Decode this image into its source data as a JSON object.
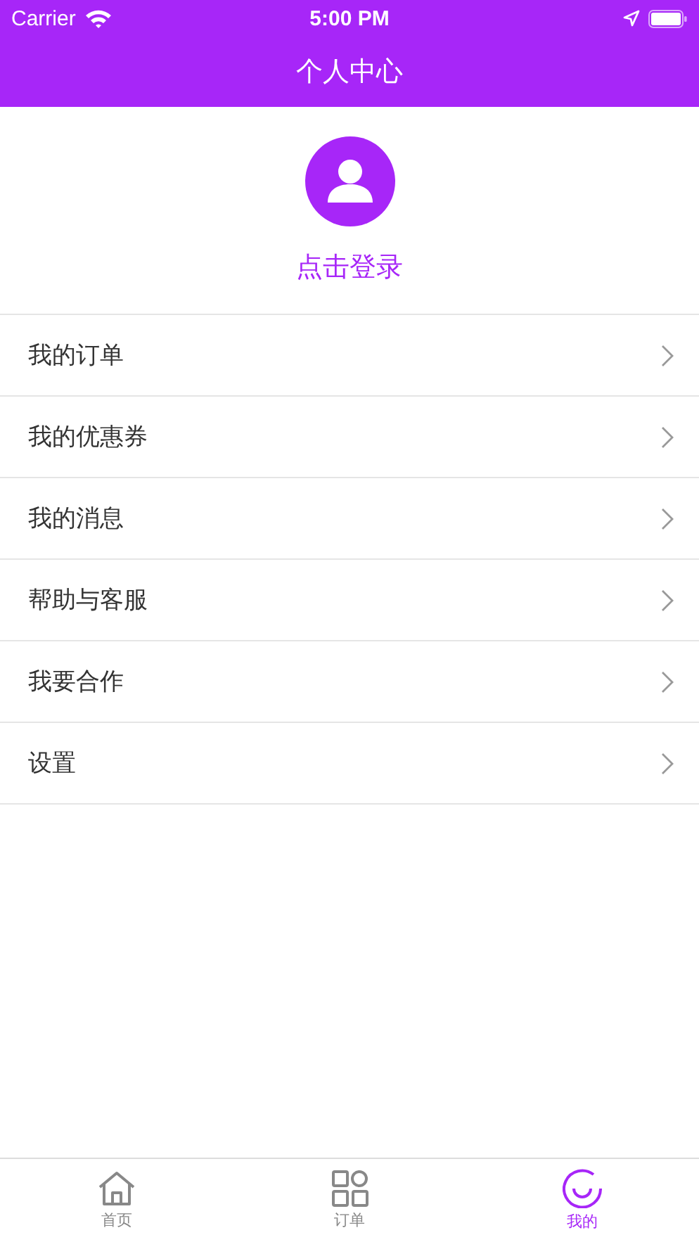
{
  "status_bar": {
    "carrier": "Carrier",
    "time": "5:00 PM"
  },
  "nav": {
    "title": "个人中心"
  },
  "profile": {
    "login": "点击登录"
  },
  "menu": [
    {
      "label": "我的订单"
    },
    {
      "label": "我的优惠券"
    },
    {
      "label": "我的消息"
    },
    {
      "label": "帮助与客服"
    },
    {
      "label": "我要合作"
    },
    {
      "label": "设置"
    }
  ],
  "tabs": [
    {
      "label": "首页",
      "kind": "home",
      "selected": false
    },
    {
      "label": "订单",
      "kind": "grid",
      "selected": false
    },
    {
      "label": "我的",
      "kind": "smile",
      "selected": true
    }
  ]
}
